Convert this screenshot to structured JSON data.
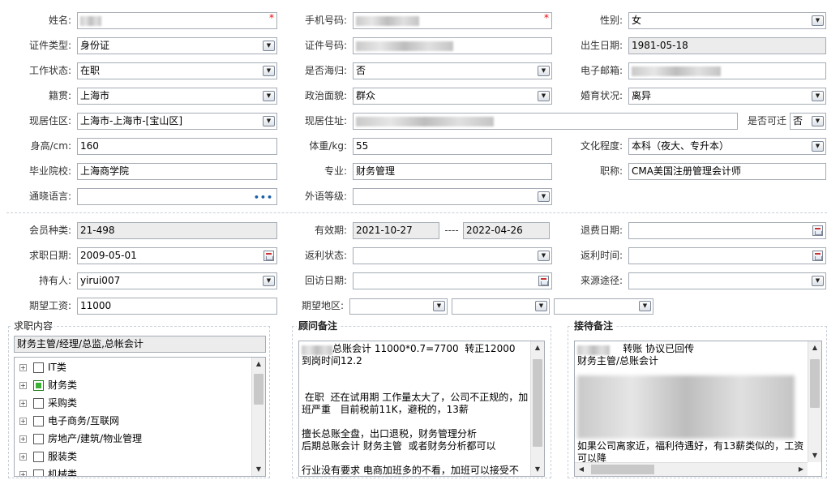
{
  "fields": {
    "name": {
      "label": "姓名:",
      "required": "*"
    },
    "phone": {
      "label": "手机号码:",
      "required": "*"
    },
    "gender": {
      "label": "性别:",
      "value": "女"
    },
    "id_type": {
      "label": "证件类型:",
      "value": "身份证"
    },
    "id_number": {
      "label": "证件号码:"
    },
    "birth_date": {
      "label": "出生日期:",
      "value": "1981-05-18"
    },
    "work_status": {
      "label": "工作状态:",
      "value": "在职"
    },
    "returnee": {
      "label": "是否海归:",
      "value": "否"
    },
    "email": {
      "label": "电子邮箱:"
    },
    "native_place": {
      "label": "籍贯:",
      "value": "上海市"
    },
    "political": {
      "label": "政治面貌:",
      "value": "群众"
    },
    "marital": {
      "label": "婚育状况:",
      "value": "离异"
    },
    "residence_area": {
      "label": "现居住区:",
      "value": "上海市-上海市-[宝山区]"
    },
    "residence_addr": {
      "label": "现居住址:"
    },
    "relocate": {
      "label": "是否可迁",
      "value": "否"
    },
    "height": {
      "label": "身高/cm:",
      "value": "160"
    },
    "weight": {
      "label": "体重/kg:",
      "value": "55"
    },
    "education": {
      "label": "文化程度:",
      "value": "本科（夜大、专升本）"
    },
    "school": {
      "label": "毕业院校:",
      "value": "上海商学院"
    },
    "major": {
      "label": "专业:",
      "value": "财务管理"
    },
    "title": {
      "label": "职称:",
      "value": "CMA美国注册管理会计师"
    },
    "language": {
      "label": "通晓语言:",
      "value": ""
    },
    "foreign_level": {
      "label": "外语等级:",
      "value": ""
    },
    "member_type": {
      "label": "会员种类:",
      "value": "21-498"
    },
    "valid_period": {
      "label": "有效期:",
      "from": "2021-10-27",
      "sep": "----",
      "to": "2022-04-26"
    },
    "refund_date": {
      "label": "退费日期:",
      "value": ""
    },
    "job_date": {
      "label": "求职日期:",
      "value": "2009-05-01"
    },
    "rebate_status": {
      "label": "返利状态:",
      "value": ""
    },
    "rebate_time": {
      "label": "返利时间:",
      "value": ""
    },
    "holder": {
      "label": "持有人:",
      "value": "yirui007"
    },
    "visit_date": {
      "label": "回访日期:",
      "value": ""
    },
    "source": {
      "label": "来源途径:",
      "value": ""
    },
    "expected_salary": {
      "label": "期望工资:",
      "value": "11000"
    },
    "expected_area": {
      "label": "期望地区:"
    }
  },
  "job_intent": {
    "title": "求职内容",
    "summary": "财务主管/经理/总监,总帐会计",
    "categories": [
      {
        "label": "IT类",
        "checked": false
      },
      {
        "label": "财务类",
        "checked": true
      },
      {
        "label": "采购类",
        "checked": false
      },
      {
        "label": "电子商务/互联网",
        "checked": false
      },
      {
        "label": "房地产/建筑/物业管理",
        "checked": false
      },
      {
        "label": "服装类",
        "checked": false
      },
      {
        "label": "机械类",
        "checked": false
      }
    ]
  },
  "consultant_note": {
    "title": "顾问备注",
    "text": "总账会计 11000*0.7=7700  转正12000  到岗时间12.2\n\n\n 在职  还在试用期 工作量太大了，公司不正规的，加班严重   目前税前11K，避税的，13薪\n\n擅长总账全盘，出口退税，财务管理分析\n后期总账会计 财务主管  或者财务分析都可以\n\n行业没有要求 电商加班多的不看，加班可以接受不"
  },
  "reception_note": {
    "title": "接待备注",
    "line1": "    转账 协议已回传",
    "line2": "财务主管/总账会计",
    "tail": "如果公司离家近，福利待遇好，有13薪类似的，工资可以降"
  },
  "icons": {
    "dropdown": "▼",
    "scroll_up": "▲",
    "scroll_down": "▼",
    "scroll_left": "◀",
    "scroll_right": "▶",
    "expand": "+",
    "ellipsis": "•••"
  }
}
